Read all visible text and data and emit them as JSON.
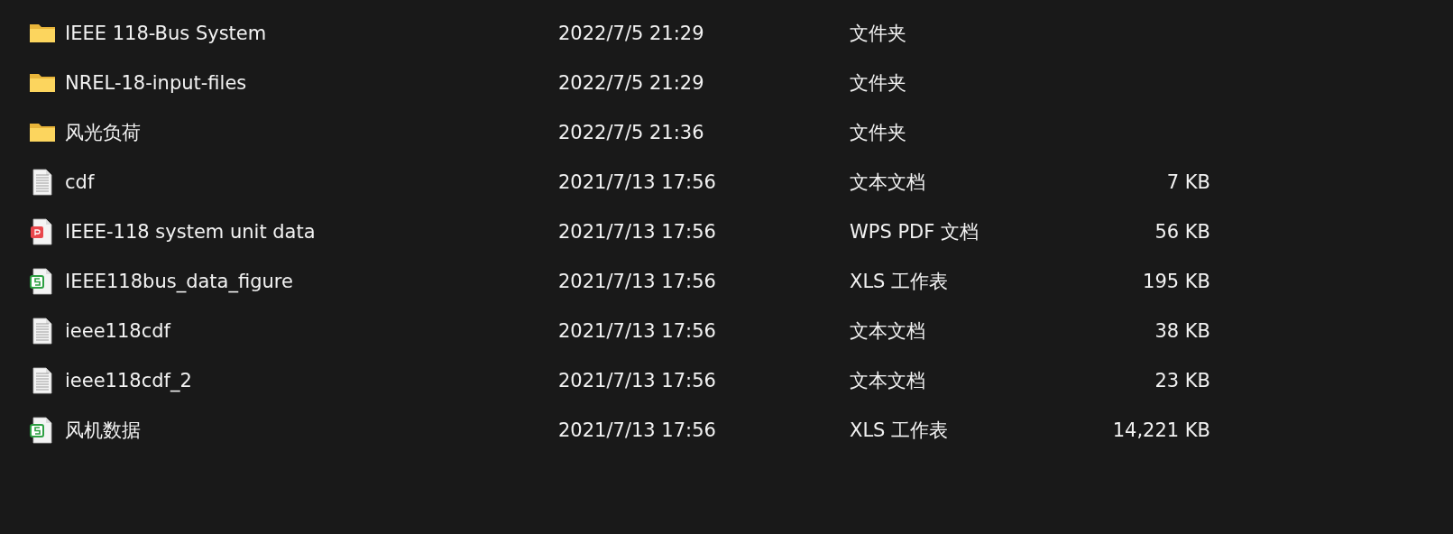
{
  "files": [
    {
      "kind": "folder",
      "name": "IEEE 118-Bus System",
      "date": "2022/7/5 21:29",
      "type": "文件夹"
    },
    {
      "kind": "folder",
      "name": "NREL-18-input-files",
      "date": "2022/7/5 21:29",
      "type": "文件夹"
    },
    {
      "kind": "folder",
      "name": "风光负荷",
      "date": "2022/7/5 21:36",
      "type": "文件夹"
    },
    {
      "kind": "text",
      "name": "cdf",
      "date": "2021/7/13 17:56",
      "type": "文本文档",
      "size": "7 KB"
    },
    {
      "kind": "pdf",
      "name": "IEEE-118 system unit data",
      "date": "2021/7/13 17:56",
      "type": "WPS PDF 文档",
      "size": "56 KB"
    },
    {
      "kind": "sheet",
      "name": "IEEE118bus_data_figure",
      "date": "2021/7/13 17:56",
      "type": "XLS 工作表",
      "size": "195 KB"
    },
    {
      "kind": "text",
      "name": "ieee118cdf",
      "date": "2021/7/13 17:56",
      "type": "文本文档",
      "size": "38 KB"
    },
    {
      "kind": "text",
      "name": "ieee118cdf_2",
      "date": "2021/7/13 17:56",
      "type": "文本文档",
      "size": "23 KB"
    },
    {
      "kind": "sheet",
      "name": "风机数据",
      "date": "2021/7/13 17:56",
      "type": "XLS 工作表",
      "size": "14,221 KB"
    }
  ]
}
